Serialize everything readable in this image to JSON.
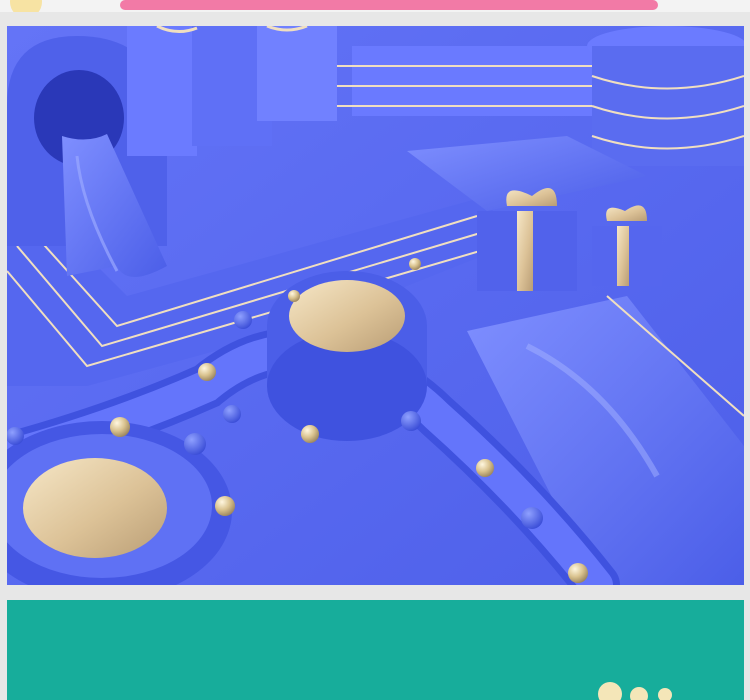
{
  "colors": {
    "page_bg": "#e7e7e7",
    "blue_scene": "#5a6cf0",
    "blue_dark": "#3d4fd9",
    "blue_light": "#7b8bff",
    "gold": "#d9c7a0",
    "pink_bar": "#f27aa6",
    "teal_scene": "#17ad9b"
  }
}
